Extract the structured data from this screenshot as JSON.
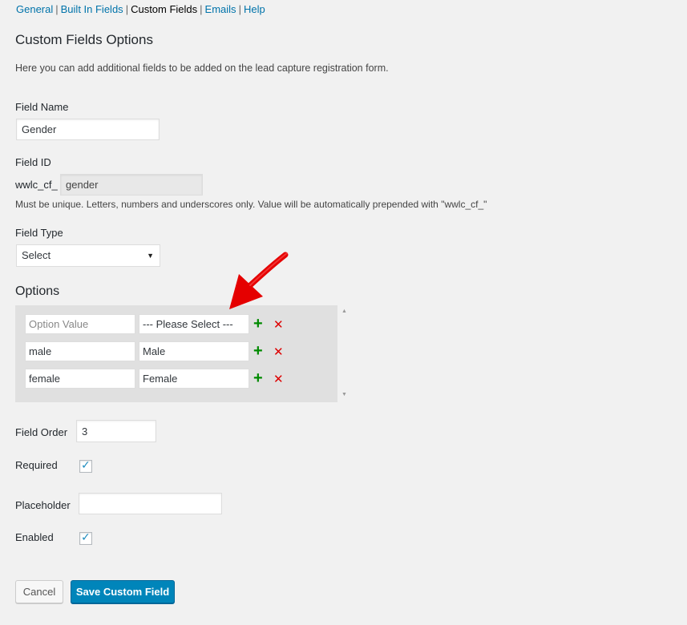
{
  "nav": {
    "items": [
      {
        "label": "General"
      },
      {
        "label": "Built In Fields"
      },
      {
        "label": "Custom Fields"
      },
      {
        "label": "Emails"
      },
      {
        "label": "Help"
      }
    ],
    "separator": "|",
    "current_index": 2
  },
  "page": {
    "title": "Custom Fields Options",
    "description": "Here you can add additional fields to be added on the lead capture registration form."
  },
  "field_name": {
    "label": "Field Name",
    "value": "Gender"
  },
  "field_id": {
    "label": "Field ID",
    "prefix": "wwlc_cf_",
    "value": "gender",
    "hint": "Must be unique. Letters, numbers and underscores only. Value will be automatically prepended with \"wwlc_cf_\""
  },
  "field_type": {
    "label": "Field Type",
    "selected": "Select"
  },
  "options": {
    "title": "Options",
    "rows": [
      {
        "value": "",
        "value_placeholder": "Option Value",
        "text": "--- Please Select ---"
      },
      {
        "value": "male",
        "value_placeholder": "",
        "text": "Male"
      },
      {
        "value": "female",
        "value_placeholder": "",
        "text": "Female"
      }
    ],
    "add_icon": "plus-icon",
    "remove_icon": "cross-icon"
  },
  "field_order": {
    "label": "Field Order",
    "value": "3"
  },
  "required": {
    "label": "Required",
    "checked": true
  },
  "placeholder": {
    "label": "Placeholder",
    "value": ""
  },
  "enabled": {
    "label": "Enabled",
    "checked": true
  },
  "buttons": {
    "cancel": "Cancel",
    "save": "Save Custom Field"
  },
  "colors": {
    "link": "#0073aa",
    "primary_button": "#0085ba",
    "add_icon": "#008a00",
    "remove_icon": "#dd0000",
    "annotation_arrow": "#e50000"
  }
}
